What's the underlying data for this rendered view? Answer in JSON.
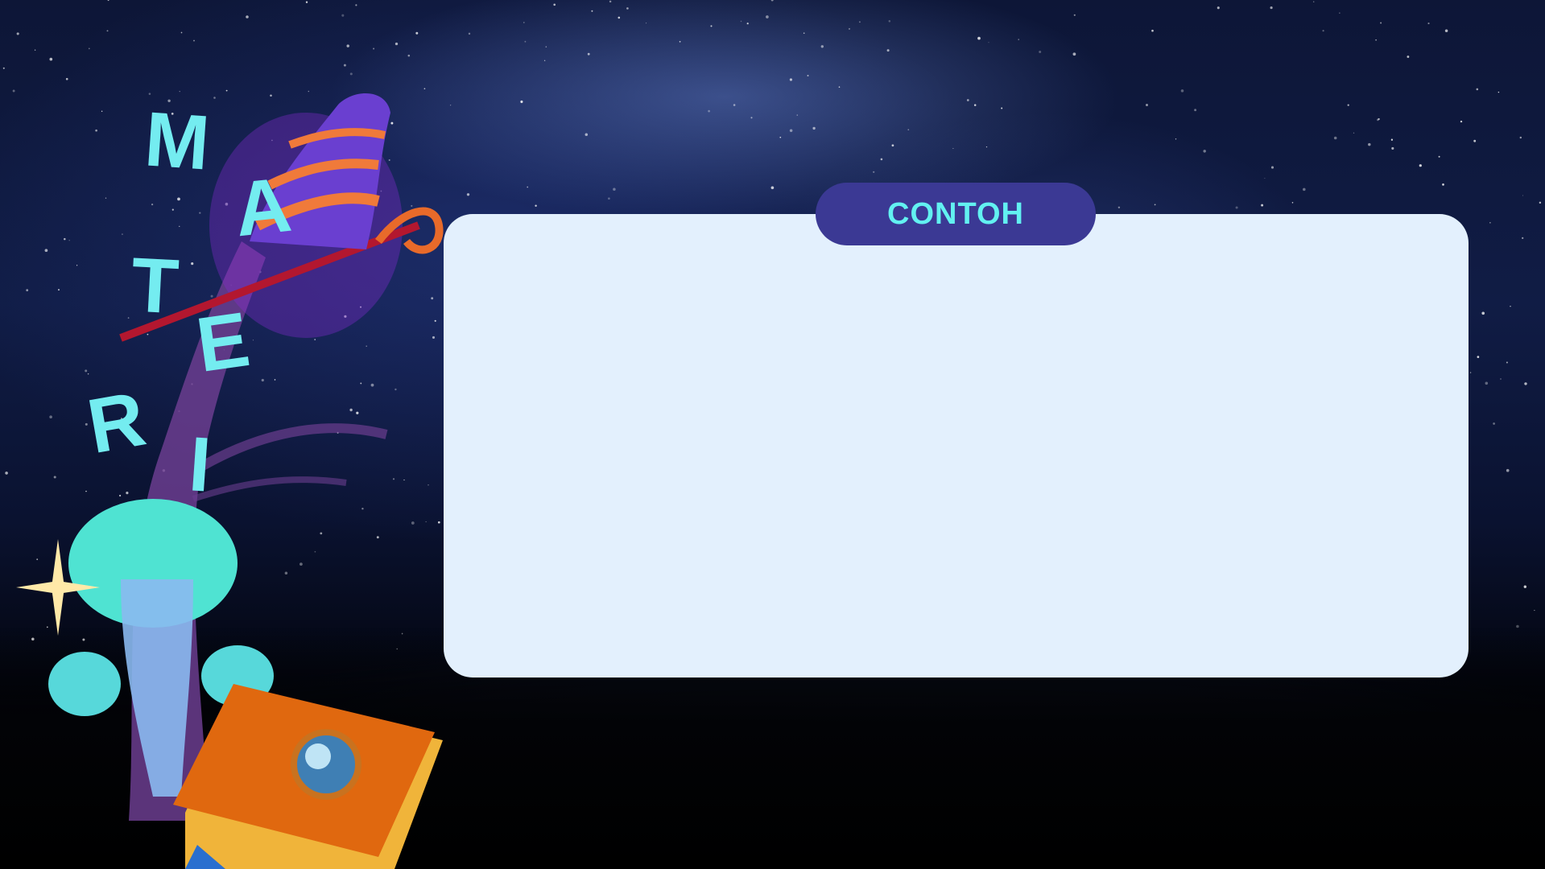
{
  "panel": {
    "tab_label": "CONTOH"
  },
  "title_letters": [
    "M",
    "A",
    "T",
    "E",
    "R",
    "I"
  ],
  "colors": {
    "panel_bg": "#e3f0fd",
    "tab_bg": "#3b3994",
    "tab_text": "#62f1f1",
    "title_text": "#74ecf0"
  },
  "decor": [
    "starry-night-sky",
    "wizard-hat",
    "magic-staff",
    "glowing-mushroom",
    "orange-book"
  ]
}
